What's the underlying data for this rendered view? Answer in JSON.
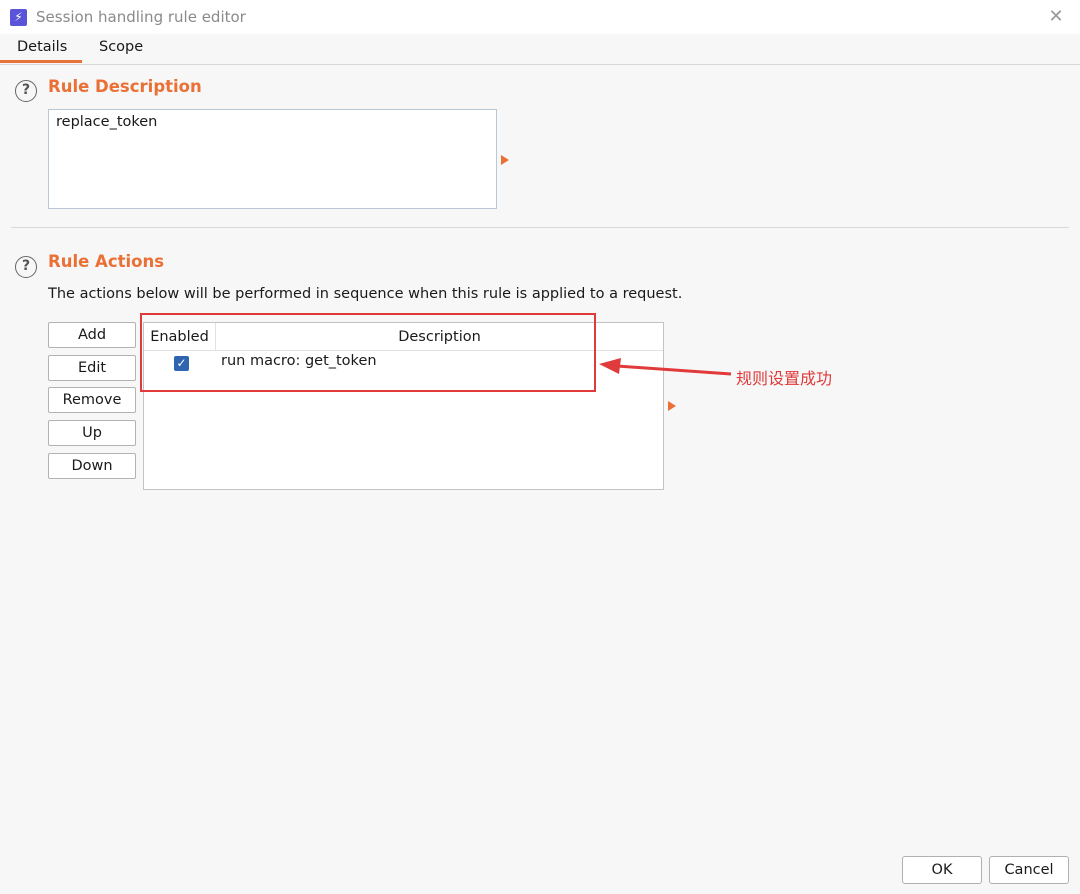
{
  "window": {
    "title": "Session handling rule editor",
    "app_icon": "lightning-icon",
    "close_icon": "close-icon",
    "close_glyph": "✕"
  },
  "tabs": [
    {
      "label": "Details",
      "active": true
    },
    {
      "label": "Scope",
      "active": false
    }
  ],
  "rule_description": {
    "title": "Rule Description",
    "value": "replace_token"
  },
  "rule_actions": {
    "title": "Rule Actions",
    "description": "The actions below will be performed in sequence when this rule is applied to a request.",
    "buttons": {
      "add": "Add",
      "edit": "Edit",
      "remove": "Remove",
      "up": "Up",
      "down": "Down"
    },
    "table": {
      "columns": [
        "Enabled",
        "Description"
      ],
      "rows": [
        {
          "enabled": true,
          "description": "run macro: get_token"
        }
      ]
    }
  },
  "annotation": {
    "text": "规则设置成功",
    "color": "#e03a3a"
  },
  "footer": {
    "ok": "OK",
    "cancel": "Cancel"
  },
  "colors": {
    "accent": "#ea7035",
    "checkbox": "#2e64b0"
  },
  "icons": {
    "help": "?",
    "check": "✓",
    "lightning": "⚡"
  }
}
